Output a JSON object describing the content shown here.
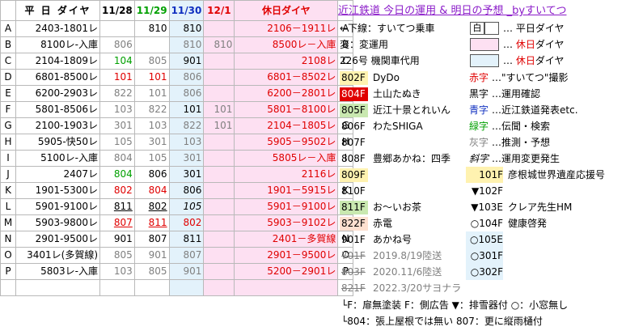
{
  "header": {
    "plan_label": "平 日 ダイヤ",
    "date1": "11/28",
    "date2": "11/29",
    "date3": "11/30",
    "date4": "12/1",
    "holiday_label": "休日ダイヤ"
  },
  "rows": [
    {
      "key": "A",
      "plan": "2403-1801レ",
      "d1": "",
      "d2": "810",
      "d3": "810",
      "d4": "",
      "holiday": "2106－1911レ",
      "key2": "A"
    },
    {
      "key": "B",
      "plan": "8100レ-入庫",
      "d1": "806",
      "d2": "",
      "d3": "810",
      "d4": "810",
      "holiday": "8500レ－入庫",
      "key2": "B"
    },
    {
      "key": "C",
      "plan": "2104-1809レ",
      "d1": "104",
      "d2": "805",
      "d3": "901",
      "d4": "",
      "holiday": "2108レ",
      "key2": "C"
    },
    {
      "key": "D",
      "plan": "6801-8500レ",
      "d1": "101",
      "d2": "101",
      "d3": "806",
      "d4": "",
      "holiday": "6801－8502レ",
      "key2": "D"
    },
    {
      "key": "E",
      "plan": "6200-2903レ",
      "d1": "822",
      "d2": "101",
      "d3": "806",
      "d4": "",
      "holiday": "6200－2801レ",
      "key2": "E"
    },
    {
      "key": "F",
      "plan": "5801-8506レ",
      "d1": "103",
      "d2": "822",
      "d3": "101",
      "d4": "101",
      "holiday": "5801－8100レ",
      "key2": "F"
    },
    {
      "key": "G",
      "plan": "2100-1903レ",
      "d1": "301",
      "d2": "103",
      "d3": "822",
      "d4": "101",
      "holiday": "2104－1805レ",
      "key2": "G"
    },
    {
      "key": "H",
      "plan": "5905-快50レ",
      "d1": "105",
      "d2": "301",
      "d3": "103",
      "d4": "",
      "holiday": "5905－9502レ",
      "key2": "H"
    },
    {
      "key": "I",
      "plan": "5100レ-入庫",
      "d1": "804",
      "d2": "105",
      "d3": "301",
      "d4": "",
      "holiday": "5805レ－入庫",
      "key2": "I"
    },
    {
      "key": "J",
      "plan": "2407レ",
      "d1": "804",
      "d2": "806",
      "d3": "301",
      "d4": "",
      "holiday": "2116レ",
      "key2": "J"
    },
    {
      "key": "K",
      "plan": "1901-5300レ",
      "d1": "802",
      "d2": "804",
      "d3": "806",
      "d4": "",
      "holiday": "1901－5915レ",
      "key2": "K"
    },
    {
      "key": "L",
      "plan": "5901-9100レ",
      "d1": "811",
      "d2": "802",
      "d3": "105",
      "d4": "",
      "holiday": "5901－9100レ",
      "key2": "L"
    },
    {
      "key": "M",
      "plan": "5903-9800レ",
      "d1": "807",
      "d2": "811",
      "d3": "802",
      "d4": "",
      "holiday": "5903－9102レ",
      "key2": "M"
    },
    {
      "key": "N",
      "plan": "2901-9500レ",
      "d1": "901",
      "d2": "807",
      "d3": "811",
      "d4": "",
      "holiday": "2401－多賀線",
      "key2": "N"
    },
    {
      "key": "O",
      "plan": "3401レ(多賀線)",
      "d1": "805",
      "d2": "901",
      "d3": "807",
      "d4": "",
      "holiday": "2901－9500レ",
      "key2": "O"
    },
    {
      "key": "P",
      "plan": "5803レ-入庫",
      "d1": "103",
      "d2": "805",
      "d3": "901",
      "d4": "",
      "holiday": "5200－2901レ",
      "key2": "P"
    }
  ],
  "right": {
    "title": "近江鉄道 今日の運用 & 明日の予想 _byすいてつ",
    "legend": [
      {
        "text": "←下線：すいてつ乗車"
      },
      {
        "text": "変：変運用"
      },
      {
        "text": "226号 機関車代用"
      }
    ],
    "box_shiro": "白",
    "legend_right": [
      "… 平日ダイヤ",
      "… 休日ダイヤ",
      "… 休日ダイヤ"
    ],
    "legend_right_red": [
      "",
      "休日",
      "休日"
    ],
    "cars": [
      {
        "no": "802F",
        "name": "DyDo"
      },
      {
        "no": "804F",
        "name": "土山たぬき"
      },
      {
        "no": "805F",
        "name": "近江十景とれいん"
      },
      {
        "no": "806F",
        "name": "わたSHIGA"
      },
      {
        "no": "807F",
        "name": ""
      },
      {
        "no": "808F",
        "name": "豊郷あかね：四季"
      },
      {
        "no": "809F",
        "name": ""
      },
      {
        "no": "810F",
        "name": ""
      },
      {
        "no": "811F",
        "name": "お～いお茶"
      },
      {
        "no": "822F",
        "name": "赤電"
      },
      {
        "no": "901F",
        "name": "あかね号"
      },
      {
        "no": "701F",
        "name": "2019.8/19陸送"
      },
      {
        "no": "803F",
        "name": "2020.11/6陸送"
      },
      {
        "no": "821F",
        "name": "2022.3/20サヨナラ"
      }
    ],
    "colorkey": [
      {
        "k": "赤字",
        "v": "…\"すいてつ\"撮影"
      },
      {
        "k": "黒字",
        "v": "…運用確認"
      },
      {
        "k": "青字",
        "v": "…近江鉄道発表etc."
      },
      {
        "k": "緑字",
        "v": "…伝聞・検索"
      },
      {
        "k": "灰字",
        "v": "…推測・予想"
      },
      {
        "k": "斜字",
        "v": "…運用変更発生"
      }
    ],
    "cars2": [
      {
        "no": "101F",
        "name": "彦根城世界遺産応援号"
      },
      {
        "no": "▼102F",
        "name": ""
      },
      {
        "no": "▼103E",
        "name": "クレア先生HM"
      },
      {
        "no": "○104F",
        "name": "健康啓発"
      },
      {
        "no": "○105E",
        "name": ""
      },
      {
        "no": "○301F",
        "name": ""
      },
      {
        "no": "○302F",
        "name": ""
      }
    ],
    "note1": "└F：扉無塗装 F：側広告 ▼：排雪器付 ○：小窓無し",
    "note2": "└804：張上屋根では無い 807：更に縦雨樋付"
  },
  "colors": {
    "pink": "#fde0f2",
    "blue": "#e3f2fb",
    "red": "#e00000",
    "green": "#00a000",
    "navy": "#1030c0",
    "gray": "#808080",
    "purple": "#8b1cc9"
  }
}
